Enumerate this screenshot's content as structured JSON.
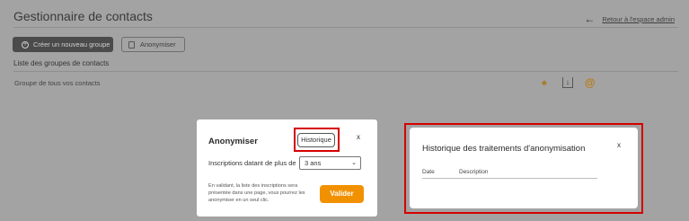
{
  "header": {
    "title": "Gestionnaire de contacts",
    "back_link": "Retour à l'espace admin"
  },
  "toolbar": {
    "create_group": "Créer un nouveau groupe",
    "anonymize": "Anonymiser"
  },
  "groups": {
    "section_title": "Liste des groupes de contacts",
    "rows": [
      {
        "name": "Groupe de tous vos contacts"
      }
    ]
  },
  "anonymize_modal": {
    "title": "Anonymiser",
    "history_button": "Historique",
    "close": "x",
    "filter_label": "Inscriptions datant de plus de",
    "selected_option": "3 ans",
    "help_text": "En validant, la liste des inscriptions sera présentée dans une page, vous pourrez les anonymiser en un seul clic.",
    "validate_button": "Valider"
  },
  "history_modal": {
    "title": "Historique des traitements d'anonymisation",
    "close": "x",
    "columns": [
      "Date",
      "Description"
    ]
  },
  "colors": {
    "accent": "#f29100",
    "highlight": "#d60000"
  }
}
